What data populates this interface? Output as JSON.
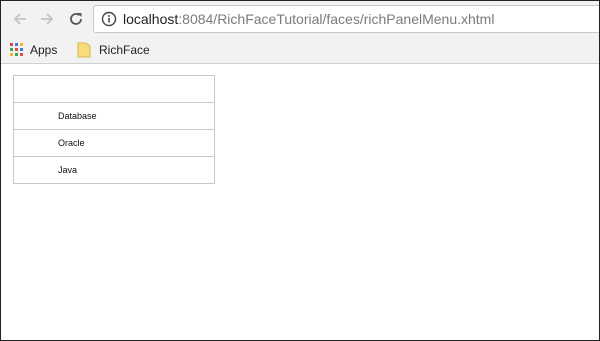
{
  "browser": {
    "url_host": "localhost",
    "url_rest": ":8084/RichFaceTutorial/faces/richPanelMenu.xhtml",
    "icons": {
      "back": "arrow-left-icon",
      "forward": "arrow-right-icon",
      "reload": "reload-icon",
      "info": "info-icon"
    }
  },
  "bookmarks": {
    "apps_label": "Apps",
    "folder_label": "RichFace"
  },
  "panel_menu": {
    "items": [
      {
        "label": "Database"
      },
      {
        "label": "Oracle"
      },
      {
        "label": "Java"
      }
    ]
  }
}
